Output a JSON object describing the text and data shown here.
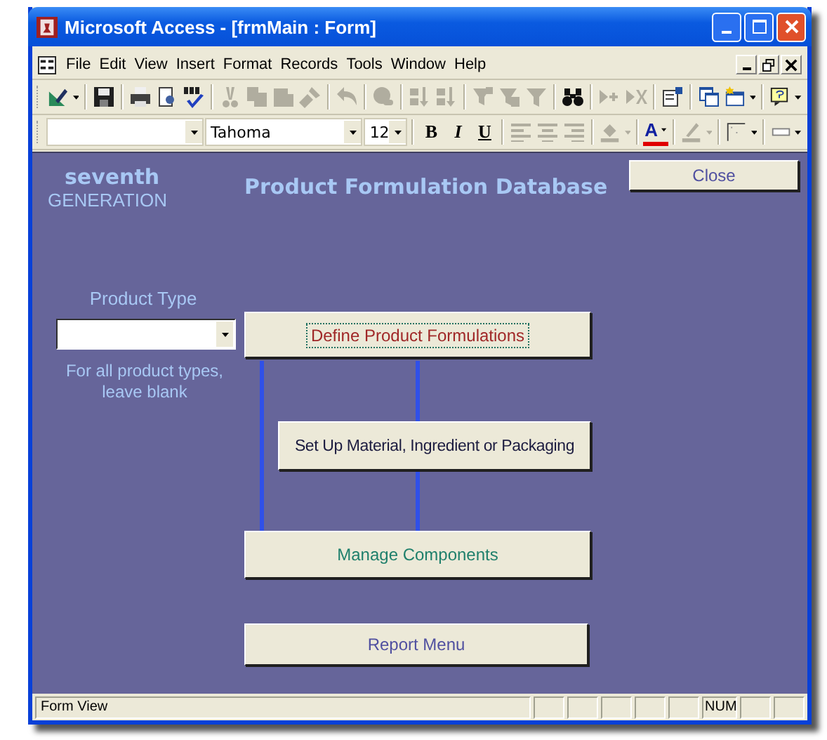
{
  "window": {
    "title": "Microsoft Access - [frmMain : Form]"
  },
  "menu": [
    {
      "label": "File"
    },
    {
      "label": "Edit"
    },
    {
      "label": "View"
    },
    {
      "label": "Insert"
    },
    {
      "label": "Format"
    },
    {
      "label": "Records"
    },
    {
      "label": "Tools"
    },
    {
      "label": "Window"
    },
    {
      "label": "Help"
    }
  ],
  "toolbar_1": [
    {
      "kind": "icon",
      "disabled": false,
      "dropdown": true
    },
    {
      "kind": "separator"
    },
    {
      "kind": "icon",
      "disabled": false,
      "dropdown": false
    },
    {
      "kind": "separator"
    },
    {
      "kind": "icon",
      "disabled": false,
      "dropdown": false
    },
    {
      "kind": "icon",
      "disabled": false,
      "dropdown": false
    },
    {
      "kind": "icon",
      "disabled": false,
      "dropdown": false
    },
    {
      "kind": "separator"
    },
    {
      "kind": "icon",
      "disabled": true,
      "dropdown": false
    },
    {
      "kind": "icon",
      "disabled": true,
      "dropdown": false
    },
    {
      "kind": "icon",
      "disabled": true,
      "dropdown": false
    },
    {
      "kind": "icon",
      "disabled": true,
      "dropdown": false
    },
    {
      "kind": "separator"
    },
    {
      "kind": "icon",
      "disabled": true,
      "dropdown": false
    },
    {
      "kind": "separator"
    },
    {
      "kind": "icon",
      "disabled": true,
      "dropdown": false
    },
    {
      "kind": "separator"
    },
    {
      "kind": "icon",
      "disabled": true,
      "dropdown": false
    },
    {
      "kind": "icon",
      "disabled": true,
      "dropdown": false
    },
    {
      "kind": "separator"
    },
    {
      "kind": "icon",
      "disabled": true,
      "dropdown": false
    },
    {
      "kind": "icon",
      "disabled": true,
      "dropdown": false
    },
    {
      "kind": "icon",
      "disabled": true,
      "dropdown": false
    },
    {
      "kind": "separator"
    },
    {
      "kind": "icon",
      "disabled": false,
      "dropdown": false
    },
    {
      "kind": "separator"
    },
    {
      "kind": "icon",
      "disabled": true,
      "dropdown": false
    },
    {
      "kind": "icon",
      "disabled": true,
      "dropdown": false
    },
    {
      "kind": "separator"
    },
    {
      "kind": "icon",
      "disabled": false,
      "dropdown": false
    },
    {
      "kind": "separator"
    },
    {
      "kind": "icon",
      "disabled": false,
      "dropdown": false
    },
    {
      "kind": "icon",
      "disabled": false,
      "dropdown": true
    },
    {
      "kind": "separator"
    },
    {
      "kind": "icon",
      "disabled": false,
      "dropdown": true
    }
  ],
  "toolbar_2": [
    {
      "kind": "combo"
    },
    {
      "kind": "combo",
      "value": "Tahoma"
    },
    {
      "kind": "combo",
      "value": "12"
    },
    {
      "kind": "separator"
    },
    {
      "kind": "text",
      "label": "B",
      "disabled": false
    },
    {
      "kind": "text",
      "label": "I",
      "disabled": false
    },
    {
      "kind": "text",
      "label": "U",
      "disabled": false
    },
    {
      "kind": "separator"
    },
    {
      "kind": "icon",
      "disabled": true,
      "dropdown": false
    },
    {
      "kind": "icon",
      "disabled": true,
      "dropdown": false
    },
    {
      "kind": "icon",
      "disabled": true,
      "dropdown": false
    },
    {
      "kind": "separator"
    },
    {
      "kind": "icon",
      "disabled": true,
      "dropdown": true
    },
    {
      "kind": "separator"
    },
    {
      "kind": "color-text",
      "label": "A",
      "color": "#e00000",
      "disabled": false,
      "dropdown": true
    },
    {
      "kind": "separator"
    },
    {
      "kind": "icon",
      "disabled": true,
      "dropdown": true
    },
    {
      "kind": "separator"
    },
    {
      "kind": "icon",
      "disabled": false,
      "dropdown": true
    },
    {
      "kind": "separator"
    },
    {
      "kind": "icon",
      "disabled": false,
      "dropdown": true
    }
  ],
  "form": {
    "logo": {
      "top": "seventh",
      "bottom": "GENERATION"
    },
    "title": "Product Formulation Database",
    "close_button": "Close",
    "product_type": {
      "label": "Product Type",
      "hint": "For all product types, leave blank"
    },
    "buttons": [
      {
        "label": "Define Product Formulations",
        "color": "#a02828",
        "focused": true
      },
      {
        "label": "Set Up Material, Ingredient or Packaging",
        "color": "#1c1c40",
        "focused": false
      },
      {
        "label": "Manage Components",
        "color": "#20806c",
        "focused": false
      },
      {
        "label": "Report Menu",
        "color": "#5050a0",
        "focused": false
      }
    ]
  },
  "status_bar": {
    "text": "Form View",
    "indicator": "NUM"
  }
}
